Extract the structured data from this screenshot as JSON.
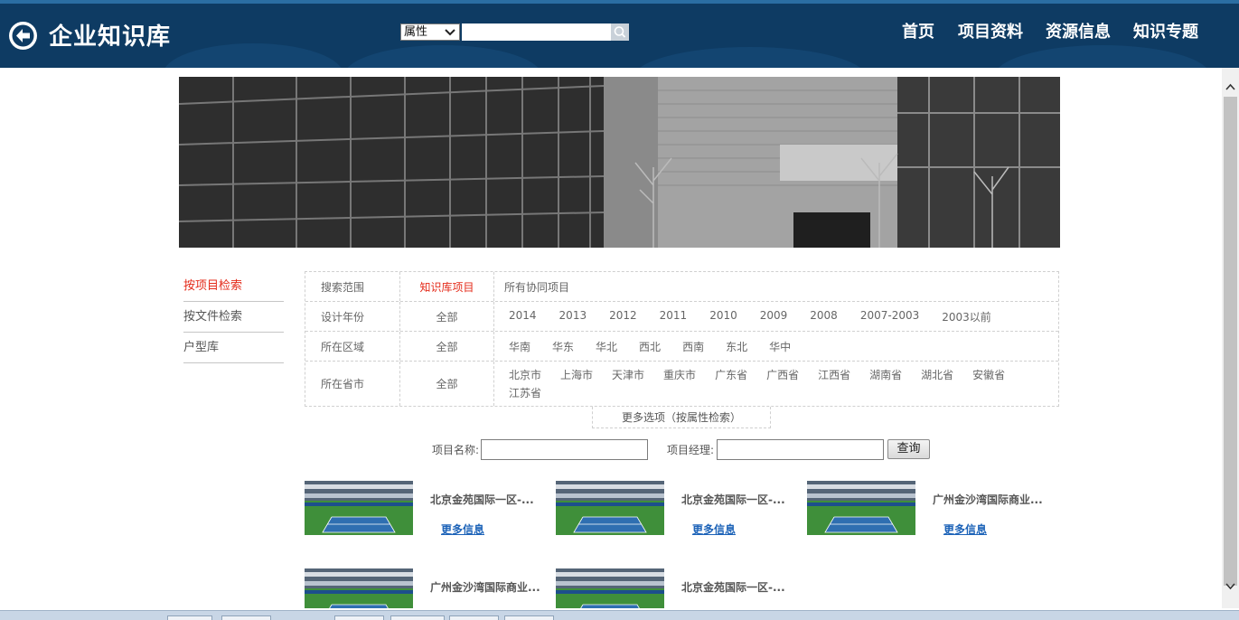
{
  "header": {
    "app_title": "企业知识库",
    "search": {
      "select_value": "属性",
      "input_value": ""
    },
    "nav": [
      "首页",
      "项目资料",
      "资源信息",
      "知识专题"
    ]
  },
  "sidebar": {
    "items": [
      {
        "label": "按项目检索",
        "active": true
      },
      {
        "label": "按文件检索",
        "active": false
      },
      {
        "label": "户型库",
        "active": false
      }
    ]
  },
  "filters": {
    "scope": {
      "label": "搜索范围",
      "selected": "知识库项目",
      "options": [
        "所有协同项目"
      ]
    },
    "year": {
      "label": "设计年份",
      "selected": "全部",
      "options": [
        "2014",
        "2013",
        "2012",
        "2011",
        "2010",
        "2009",
        "2008",
        "2007-2003",
        "2003以前"
      ]
    },
    "region": {
      "label": "所在区域",
      "selected": "全部",
      "options": [
        "华南",
        "华东",
        "华北",
        "西北",
        "西南",
        "东北",
        "华中"
      ]
    },
    "province": {
      "label": "所在省市",
      "selected": "全部",
      "options": [
        "北京市",
        "上海市",
        "天津市",
        "重庆市",
        "广东省",
        "广西省",
        "江西省",
        "湖南省",
        "湖北省",
        "安徽省",
        "江苏省"
      ]
    },
    "more_label": "更多选项（按属性检索）"
  },
  "query": {
    "project_name_label": "项目名称:",
    "project_name_value": "",
    "manager_label": "项目经理:",
    "manager_value": "",
    "button_label": "查询"
  },
  "projects": [
    {
      "title": "北京金苑国际一区-...",
      "link": "更多信息"
    },
    {
      "title": "北京金苑国际一区-...",
      "link": "更多信息"
    },
    {
      "title": "广州金沙湾国际商业...",
      "link": "更多信息"
    },
    {
      "title": "广州金沙湾国际商业...",
      "link": ""
    },
    {
      "title": "北京金苑国际一区-...",
      "link": ""
    }
  ],
  "colors": {
    "header_bg": "#0e3b63",
    "accent_red": "#e42b1a",
    "link_blue": "#1d63b8"
  }
}
